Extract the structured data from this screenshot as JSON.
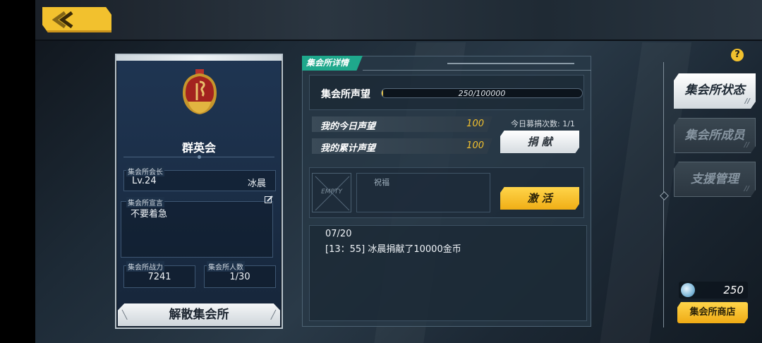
{
  "guild": {
    "name": "群英会",
    "leader_label": "集会所会长",
    "leader_level": "Lv.24",
    "leader_name": "冰晨",
    "manifesto_label": "集会所宣言",
    "manifesto_text": "不要着急",
    "power_label": "集会所战力",
    "power_value": "7241",
    "members_label": "集会所人数",
    "members_value": "1/30",
    "disband_label": "解散集会所"
  },
  "details": {
    "tab_label": "集会所详情",
    "reputation_label": "集会所声望",
    "reputation_text": "250/100000",
    "reputation_progress": 0.0025,
    "today_label": "我的今日声望",
    "today_value": "100",
    "total_label": "我的累计声望",
    "total_value": "100",
    "donate_count": "今日募捐次数: 1/1",
    "donate_button": "捐 献",
    "empty_slot": "EMPTY",
    "blessing_label": "祝福",
    "activate_button": "激 活",
    "log": [
      "07/20",
      "[13：55] 冰晨捐献了10000金币"
    ]
  },
  "nav": {
    "help": "?",
    "items": [
      {
        "label": "集会所状态",
        "active": true
      },
      {
        "label": "集会所成员",
        "active": false
      },
      {
        "label": "支援管理",
        "active": false
      }
    ]
  },
  "currency": {
    "value": "250"
  },
  "shop_button": "集会所商店",
  "colors": {
    "accent": "#f2c12e",
    "teal_tab": "#1fa88c",
    "panel_blue": "#1d3149"
  },
  "icons": {
    "back": "back-chevron-icon",
    "edit": "edit-icon",
    "coin": "crystal-coin-icon",
    "emblem": "guild-emblem-icon"
  }
}
